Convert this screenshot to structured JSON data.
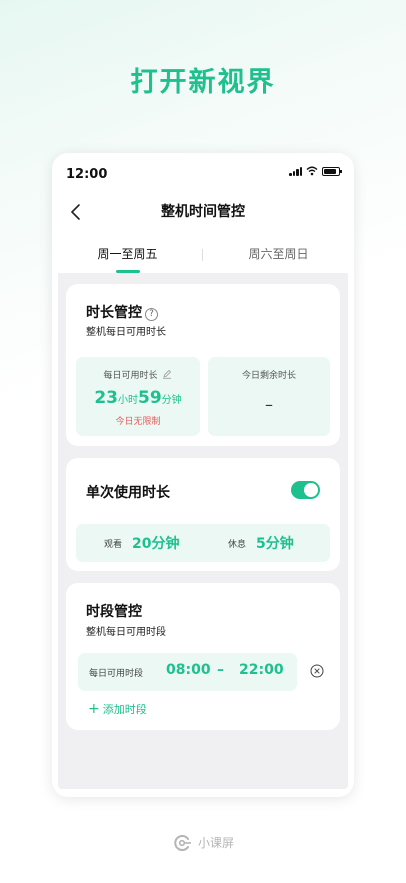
{
  "headline": "打开新视界",
  "status_bar": {
    "time": "12:00"
  },
  "nav": {
    "title": "整机时间管控"
  },
  "tabs": [
    {
      "label": "周一至周五",
      "active": true
    },
    {
      "label": "周六至周日",
      "active": false
    }
  ],
  "duration_card": {
    "title": "时长管控",
    "help": "?",
    "subtitle": "整机每日可用时长",
    "daily_label": "每日可用时长",
    "daily_hours": "23",
    "hours_unit": "小时",
    "daily_minutes": "59",
    "minutes_unit": "分钟",
    "unlimited_note": "今日无限制",
    "remaining_label": "今日剩余时长",
    "remaining_value": "–"
  },
  "single_use_card": {
    "title": "单次使用时长",
    "toggle_on": true,
    "watch_label": "观看",
    "watch_value": "20分钟",
    "rest_label": "休息",
    "rest_value": "5分钟"
  },
  "period_card": {
    "title": "时段管控",
    "subtitle": "整机每日可用时段",
    "period_label": "每日可用时段",
    "start": "08:00",
    "dash": "–",
    "end": "22:00",
    "add_label": "添加时段"
  },
  "brand": {
    "name": "小课屏"
  },
  "colors": {
    "accent": "#1ec08e",
    "warning": "#e85d5d",
    "panel": "#ebf8f3",
    "background": "#f0f0f2"
  },
  "icons": [
    "back-icon",
    "help-icon",
    "edit-icon",
    "remove-icon",
    "plus-icon",
    "brand-logo-icon",
    "signal-icon",
    "wifi-icon",
    "battery-icon"
  ]
}
